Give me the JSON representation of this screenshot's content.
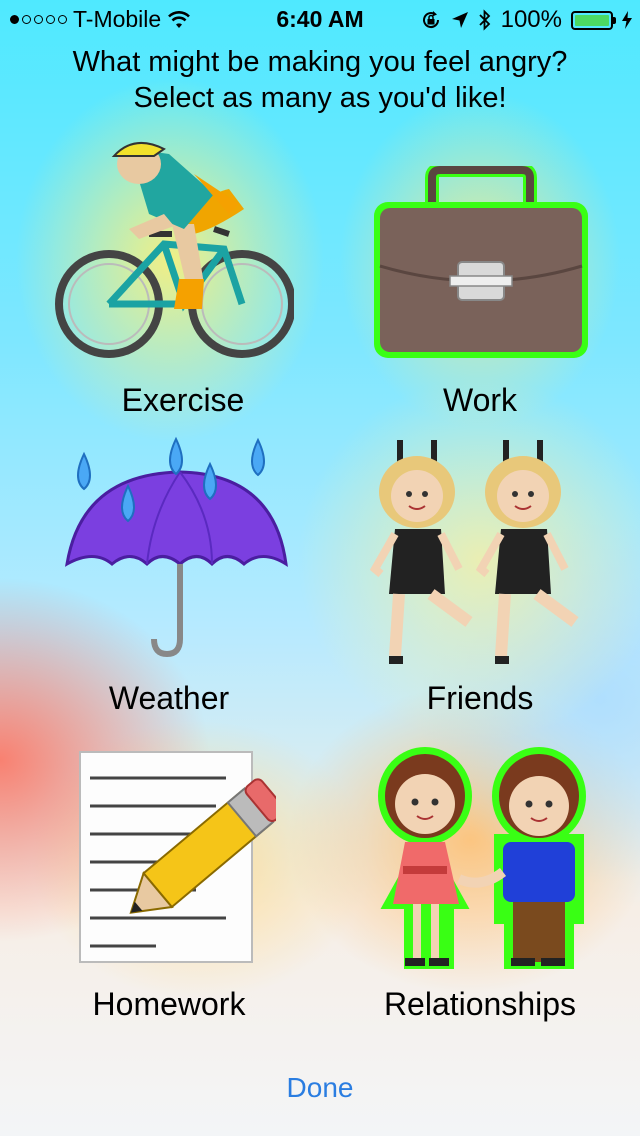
{
  "status_bar": {
    "carrier": "T-Mobile",
    "time": "6:40 AM",
    "battery": "100%",
    "signal_bars": 1
  },
  "prompt": {
    "line1": "What might be making you feel angry?",
    "line2": "Select as many as you'd like!"
  },
  "options": [
    {
      "label": "Exercise",
      "icon": "cyclist-icon",
      "selected": false
    },
    {
      "label": "Work",
      "icon": "briefcase-icon",
      "selected": true
    },
    {
      "label": "Weather",
      "icon": "umbrella-rain-icon",
      "selected": false
    },
    {
      "label": "Friends",
      "icon": "dancers-icon",
      "selected": false
    },
    {
      "label": "Homework",
      "icon": "memo-pencil-icon",
      "selected": false
    },
    {
      "label": "Relationships",
      "icon": "couple-icon",
      "selected": true
    }
  ],
  "done_label": "Done",
  "colors": {
    "selection_outline": "#39ff14",
    "done_text": "#2a7de1",
    "battery_fill": "#4cd964"
  }
}
